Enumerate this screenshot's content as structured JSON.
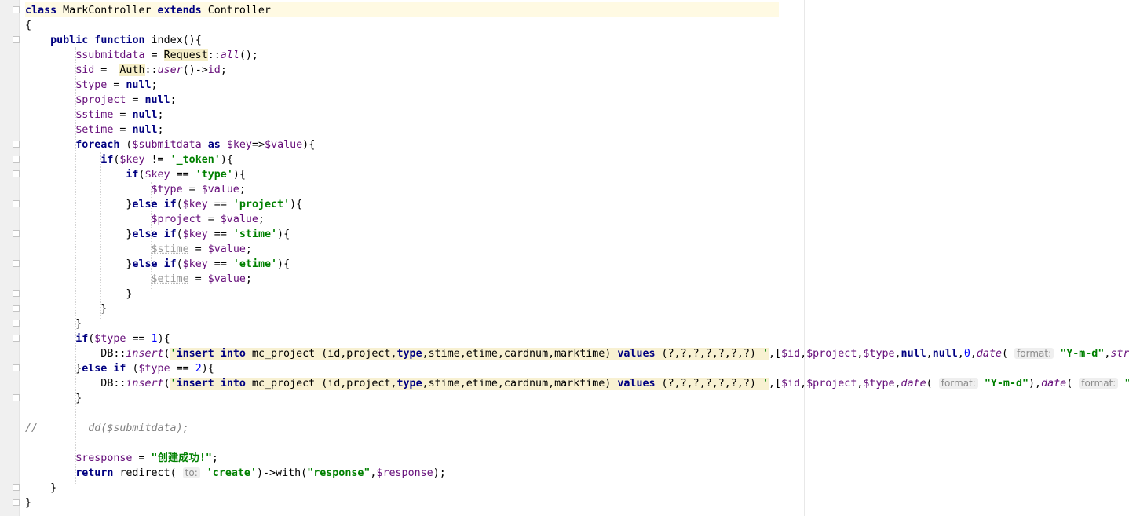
{
  "editor": {
    "lines": [
      "class MarkController extends Controller",
      "{",
      "    public function index(){",
      "        $submitdata = Request::all();",
      "        $id =  Auth::user()->id;",
      "        $type = null;",
      "        $project = null;",
      "        $stime = null;",
      "        $etime = null;",
      "        foreach ($submitdata as $key=>$value){",
      "            if($key != '_token'){",
      "                if($key == 'type'){",
      "                    $type = $value;",
      "                }else if($key == 'project'){",
      "                    $project = $value;",
      "                }else if($key == 'stime'){",
      "                    $stime = $value;",
      "                }else if($key == 'etime'){",
      "                    $etime = $value;",
      "                }",
      "            }",
      "        }",
      "        if($type == 1){",
      "            DB::insert('insert into mc_project (id,project,type,stime,etime,cardnum,marktime) values (?,?,?,?,?,?,?) ',[$id,$project,$type,null,null,0,date( format: \"Y-m-d\",str",
      "        }else if ($type == 2){",
      "            DB::insert('insert into mc_project (id,project,type,stime,etime,cardnum,marktime) values (?,?,?,?,?,?,?) ',[$id,$project,$type,date( format: \"Y-m-d\"),date( format: \"",
      "        }",
      "",
      "//        dd($submitdata);",
      "",
      "        $response = \"创建成功!\";",
      "        return redirect( to: 'create')->with(\"response\",$response);",
      "    }",
      "}"
    ]
  }
}
